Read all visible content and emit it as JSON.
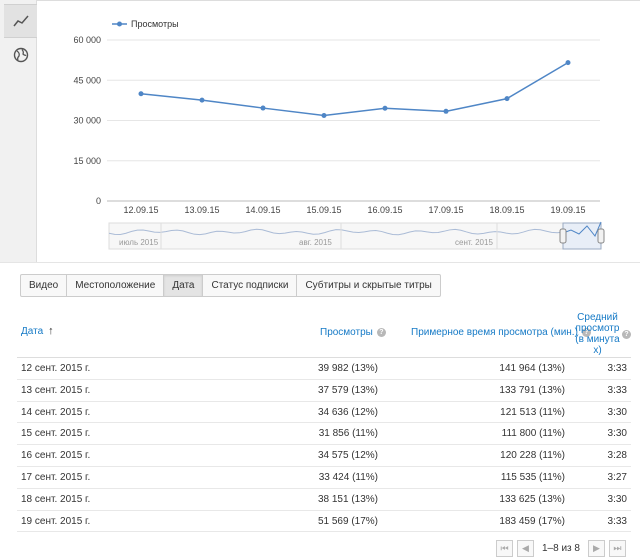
{
  "sidebar": {
    "buttons": [
      {
        "name": "line-chart",
        "icon": "line-chart-icon"
      },
      {
        "name": "map",
        "icon": "globe-icon"
      }
    ]
  },
  "chart_data": {
    "type": "line",
    "x": [
      "12.09.15",
      "13.09.15",
      "14.09.15",
      "15.09.15",
      "16.09.15",
      "17.09.15",
      "18.09.15",
      "19.09.15"
    ],
    "series": [
      {
        "name": "Просмотры",
        "values": [
          39982,
          37579,
          34636,
          31856,
          34575,
          33424,
          38151,
          51569
        ],
        "color": "#4f86c6"
      }
    ],
    "y_ticks": [
      "60 000",
      "45 000",
      "30 000",
      "15 000",
      "0"
    ],
    "y_tick_values": [
      60000,
      45000,
      30000,
      15000,
      0
    ],
    "ylim": [
      0,
      60000
    ],
    "grid": true,
    "legend": "top-left",
    "navigator_labels": [
      "июль 2015",
      "авг. 2015",
      "сент. 2015"
    ]
  },
  "tabs": [
    {
      "label": "Видео",
      "active": false
    },
    {
      "label": "Местоположение",
      "active": false
    },
    {
      "label": "Дата",
      "active": true
    },
    {
      "label": "Статус подписки",
      "active": false
    },
    {
      "label": "Субтитры и скрытые титры",
      "active": false
    }
  ],
  "table": {
    "headers": {
      "date": "Дата",
      "views": "Просмотры",
      "watch": "Примерное время просмотра (мин.)",
      "avg_line1": "Средний",
      "avg_line2": "просмотр",
      "avg_line3": "(в минута",
      "avg_line4": "х)",
      "help": "?"
    },
    "rows": [
      {
        "date": "12 сент. 2015 г.",
        "views": "39 982 (13%)",
        "watch": "141 964 (13%)",
        "avg": "3:33"
      },
      {
        "date": "13 сент. 2015 г.",
        "views": "37 579 (13%)",
        "watch": "133 791 (13%)",
        "avg": "3:33"
      },
      {
        "date": "14 сент. 2015 г.",
        "views": "34 636 (12%)",
        "watch": "121 513 (11%)",
        "avg": "3:30"
      },
      {
        "date": "15 сент. 2015 г.",
        "views": "31 856 (11%)",
        "watch": "111 800 (11%)",
        "avg": "3:30"
      },
      {
        "date": "16 сент. 2015 г.",
        "views": "34 575 (12%)",
        "watch": "120 228 (11%)",
        "avg": "3:28"
      },
      {
        "date": "17 сент. 2015 г.",
        "views": "33 424 (11%)",
        "watch": "115 535 (11%)",
        "avg": "3:27"
      },
      {
        "date": "18 сент. 2015 г.",
        "views": "38 151 (13%)",
        "watch": "133 625 (13%)",
        "avg": "3:30"
      },
      {
        "date": "19 сент. 2015 г.",
        "views": "51 569 (17%)",
        "watch": "183 459 (17%)",
        "avg": "3:33"
      }
    ]
  },
  "pager": {
    "text": "1–8 из 8",
    "first": "⏮",
    "prev": "◀",
    "next": "▶",
    "last": "⏭"
  }
}
